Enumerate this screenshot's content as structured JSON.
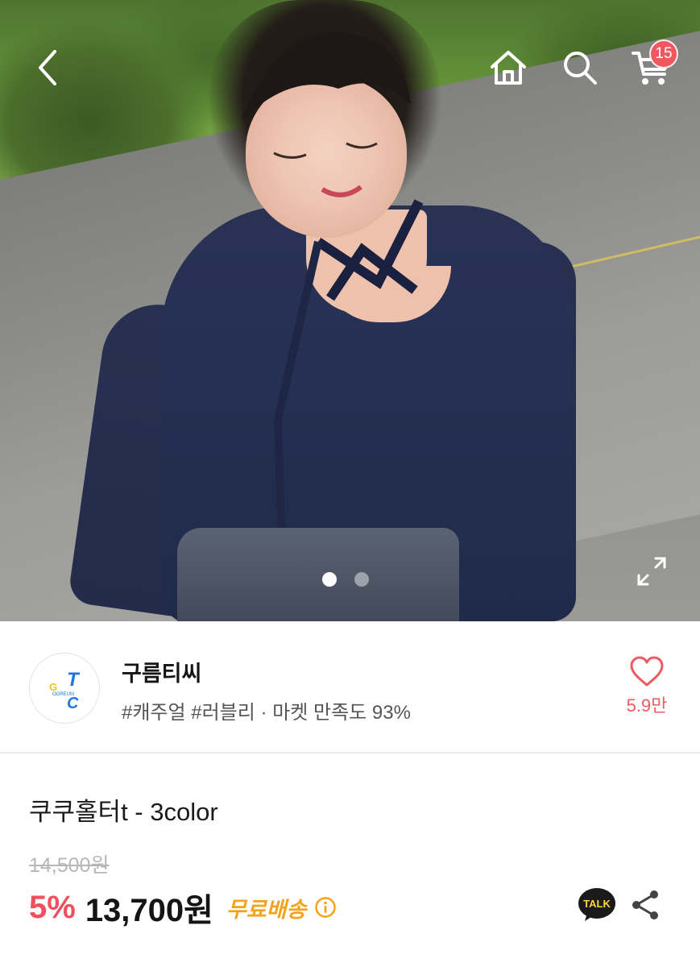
{
  "header": {
    "cart_count": "15"
  },
  "gallery": {
    "total_images": 2,
    "current_index": 1
  },
  "seller": {
    "name": "구름티씨",
    "tags": "#캐주얼 #러블리 · 마켓 만족도 93%",
    "logo_text": {
      "g": "G",
      "t": "T",
      "c": "C",
      "ring": "OOREUM"
    },
    "likes": "5.9만"
  },
  "product": {
    "title": "쿠쿠홀터t - 3color",
    "original_price": "14,500원",
    "discount": "5%",
    "price": "13,700원",
    "shipping": "무료배송"
  },
  "actions": {
    "talk_label": "TALK"
  },
  "colors": {
    "accent": "#f0505d",
    "badge": "#f2575f",
    "shipping": "#f4a31e",
    "like": "#ee5a63"
  },
  "icons": [
    "back-arrow-icon",
    "home-icon",
    "search-icon",
    "cart-icon",
    "expand-icon",
    "heart-icon",
    "info-icon",
    "talk-icon",
    "share-icon"
  ]
}
